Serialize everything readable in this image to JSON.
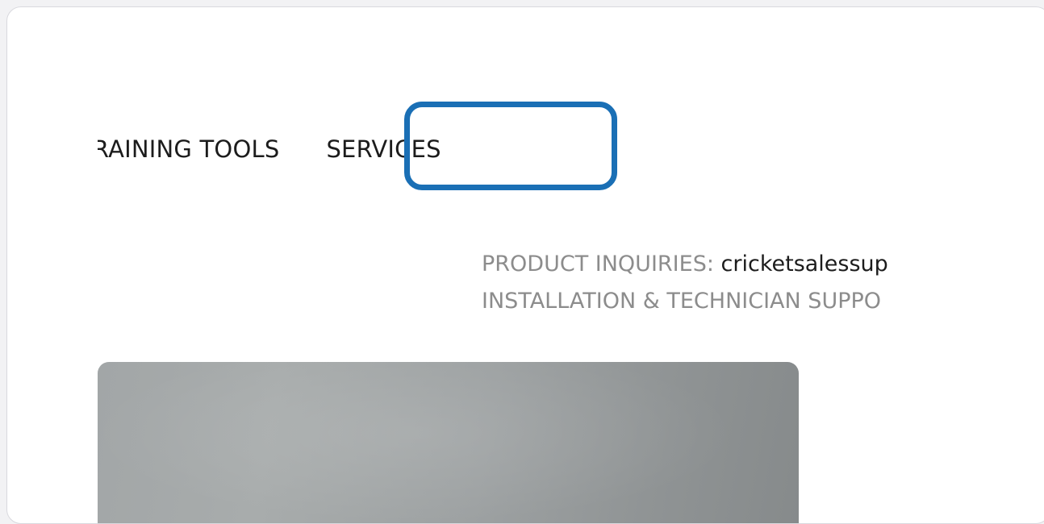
{
  "nav": {
    "items": [
      {
        "label": "TRAINING TOOLS"
      },
      {
        "label": "SERVICES"
      }
    ]
  },
  "contact": {
    "product_label": "PRODUCT INQUIRIES:",
    "product_email": "cricketsalessup",
    "support_label": "INSTALLATION & TECHNICIAN SUPPO"
  },
  "colors": {
    "highlight": "#1a6fb5",
    "label_gray": "#8c8c8c",
    "text_dark": "#1c1c1c"
  }
}
